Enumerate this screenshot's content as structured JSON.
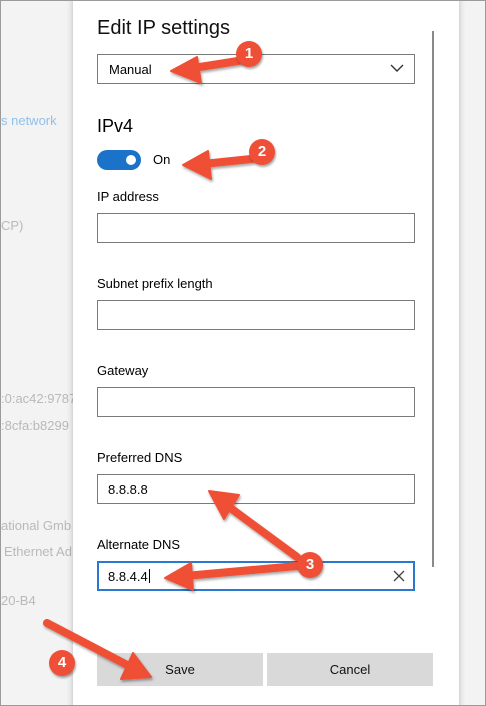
{
  "background": {
    "fragments": [
      "s network",
      "CP)",
      ":0:ac42:9787",
      ":8cfa:b8299",
      "ational Gmb",
      "Ethernet Ad",
      "20-B4"
    ]
  },
  "dialog": {
    "title": "Edit IP settings",
    "mode_select": {
      "value": "Manual",
      "icon": "chevron-down-icon"
    },
    "ipv4": {
      "section_title": "IPv4",
      "toggle": {
        "state_label": "On",
        "on": true,
        "color": "#1a73c8"
      },
      "fields": [
        {
          "label": "IP address",
          "value": ""
        },
        {
          "label": "Subnet prefix length",
          "value": ""
        },
        {
          "label": "Gateway",
          "value": ""
        },
        {
          "label": "Preferred DNS",
          "value": "8.8.8.8"
        },
        {
          "label": "Alternate DNS",
          "value": "8.8.4.4",
          "focused": true
        }
      ]
    },
    "buttons": {
      "save": "Save",
      "cancel": "Cancel"
    }
  },
  "annotations": {
    "color": "#ef4f36",
    "badges": [
      "1",
      "2",
      "3",
      "4"
    ]
  }
}
